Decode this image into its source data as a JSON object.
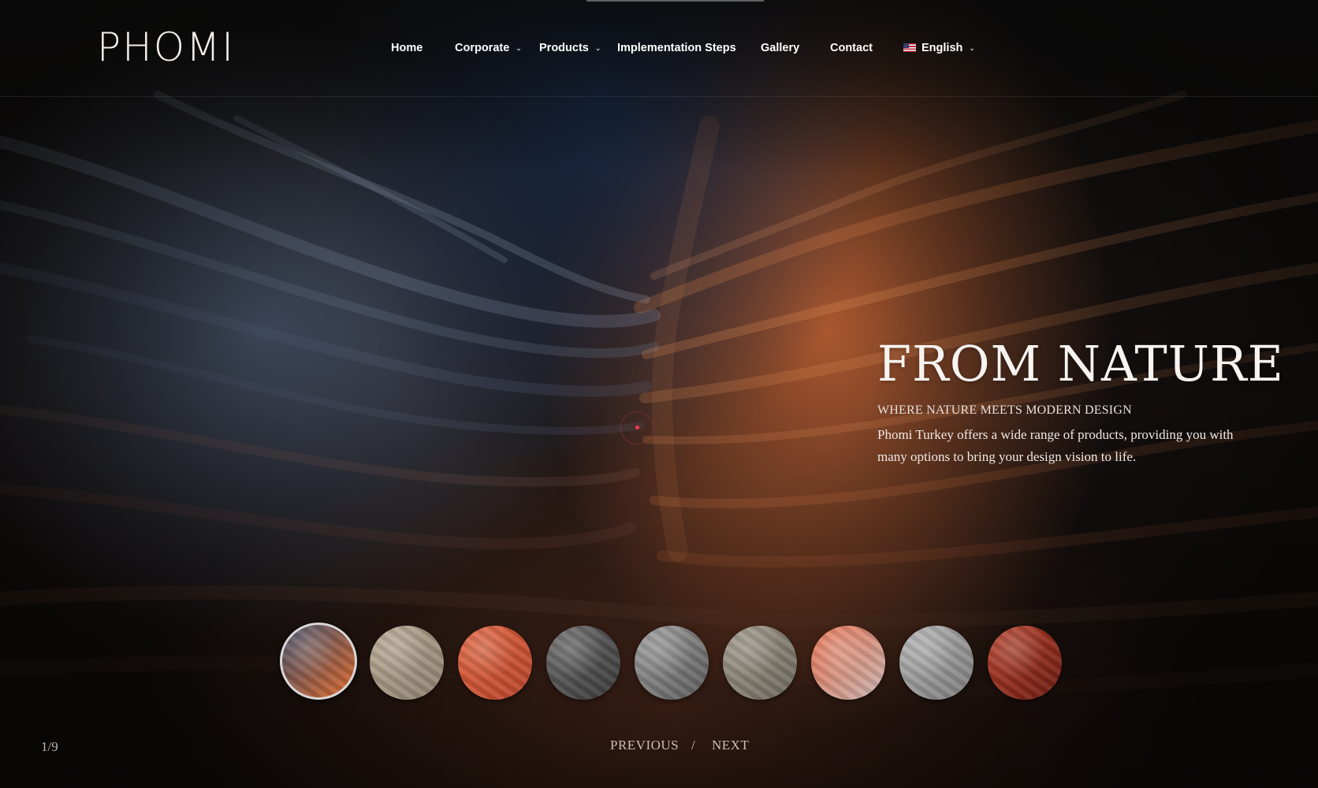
{
  "header": {
    "logo_text": "PHOMI",
    "nav": [
      {
        "label": "Home",
        "has_dropdown": false
      },
      {
        "label": "Corporate",
        "has_dropdown": true
      },
      {
        "label": "Products",
        "has_dropdown": true
      },
      {
        "label": "Implementation Steps",
        "has_dropdown": false
      },
      {
        "label": "Gallery",
        "has_dropdown": false
      },
      {
        "label": "Contact",
        "has_dropdown": false
      }
    ],
    "language": {
      "label": "English",
      "flag_icon": "us-flag-icon"
    }
  },
  "slide": {
    "title": "FROM NATURE",
    "subtitle": "WHERE NATURE MEETS MODERN DESIGN",
    "description": "Phomi Turkey offers a wide range of products, providing you with many options to bring your design vision to life."
  },
  "thumbnails": [
    {
      "name": "canyon-blue-orange",
      "colors": [
        "#3b4a66",
        "#e06b2e"
      ],
      "active": true
    },
    {
      "name": "beige-stone",
      "colors": [
        "#b8a991",
        "#8e8373"
      ],
      "active": false
    },
    {
      "name": "orange-sandstone",
      "colors": [
        "#e2643f",
        "#b7472d"
      ],
      "active": false
    },
    {
      "name": "dark-slate",
      "colors": [
        "#6a6a6a",
        "#3b3b3b"
      ],
      "active": false
    },
    {
      "name": "grey-marble",
      "colors": [
        "#9d9d9d",
        "#5d5d5d"
      ],
      "active": false
    },
    {
      "name": "taupe-stone",
      "colors": [
        "#a09989",
        "#6f6a60"
      ],
      "active": false
    },
    {
      "name": "canyon-sunset",
      "colors": [
        "#e86d4b",
        "#c9b9b6"
      ],
      "active": false
    },
    {
      "name": "light-grey-granite",
      "colors": [
        "#b5b5b5",
        "#7d7d7d"
      ],
      "active": false
    },
    {
      "name": "red-rock",
      "colors": [
        "#b8412b",
        "#6d1c13"
      ],
      "active": false
    }
  ],
  "slider": {
    "counter": "1/9",
    "previous_label": "PREVIOUS",
    "separator": "/",
    "next_label": "NEXT"
  },
  "colors": {
    "background": "#0d0a09",
    "text_primary": "#ffffff",
    "canyon_orange": "#d06a34",
    "canyon_blue": "#45526b"
  }
}
